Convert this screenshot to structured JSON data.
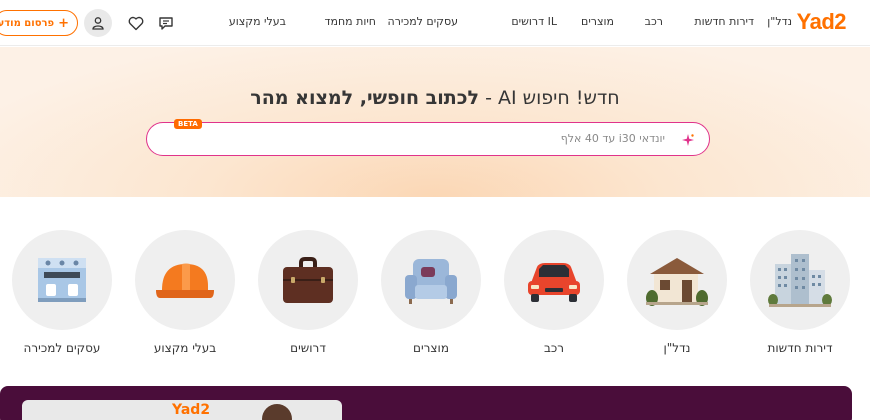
{
  "header": {
    "logo": "Yad2",
    "nav": [
      "נדל\"ן",
      "דירות חדשות",
      "רכב",
      "מוצרים",
      "דרושים IL",
      "עסקים למכירה",
      "חיות מחמד",
      "בעלי מקצוע"
    ],
    "post_button": "פרסום מודעה",
    "post_icon": "+"
  },
  "hero": {
    "title_prefix": "חדש! חיפוש AI -",
    "title_bold": "לכתוב חופשי, למצוא מהר",
    "search_placeholder": "יונדאי i30 עד 40 אלף",
    "beta_badge": "BETA"
  },
  "categories": [
    {
      "label": "דירות חדשות",
      "icon": "buildings-icon"
    },
    {
      "label": "נדל\"ן",
      "icon": "house-icon"
    },
    {
      "label": "רכב",
      "icon": "car-icon"
    },
    {
      "label": "מוצרים",
      "icon": "armchair-icon"
    },
    {
      "label": "דרושים",
      "icon": "briefcase-icon"
    },
    {
      "label": "בעלי מקצוע",
      "icon": "hardhat-icon"
    },
    {
      "label": "עסקים למכירה",
      "icon": "coffee-machine-icon"
    }
  ],
  "banner": {
    "logo": "Yad2"
  },
  "colors": {
    "brand_orange": "#ff7100",
    "search_border": "#e0338b",
    "banner_bg": "#4a0d3a"
  }
}
